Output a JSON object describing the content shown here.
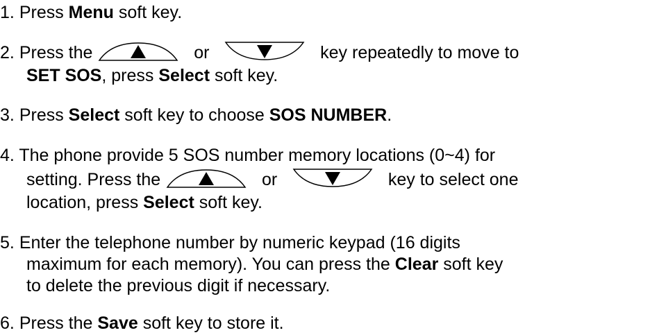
{
  "steps": [
    {
      "num": "1.",
      "a": "Press ",
      "b1": "Menu",
      "c": " soft key."
    },
    {
      "num": "2.",
      "a": "Press the ",
      "or": "or",
      "tail": "key repeatedly to move to",
      "l2_b1": "SET SOS",
      "l2_a": ", press ",
      "l2_b2": "Select",
      "l2_c": " soft key."
    },
    {
      "num": "3.",
      "a": "Press ",
      "b1": "Select",
      "c": " soft key to choose ",
      "b2": "SOS NUMBER",
      "d": "."
    },
    {
      "num": "4.",
      "a": "The phone provide 5 SOS number memory locations (0~4) for",
      "l2_a": "setting. Press the ",
      "or": "or",
      "tail": "key to select one",
      "l3_a": "location, press ",
      "l3_b": "Select",
      "l3_c": " soft key."
    },
    {
      "num": "5.",
      "a": "Enter the telephone number by numeric keypad (16 digits",
      "l2": "maximum for each memory). You can press the ",
      "l2_b": "Clear",
      "l2_c": " soft key",
      "l3": "to delete the previous digit if necessary."
    },
    {
      "num": "6.",
      "a": "Press the ",
      "b1": "Save",
      "c": " soft key to store it."
    }
  ],
  "icons": {
    "up": "up-arrow-key-icon",
    "down": "down-arrow-key-icon"
  }
}
